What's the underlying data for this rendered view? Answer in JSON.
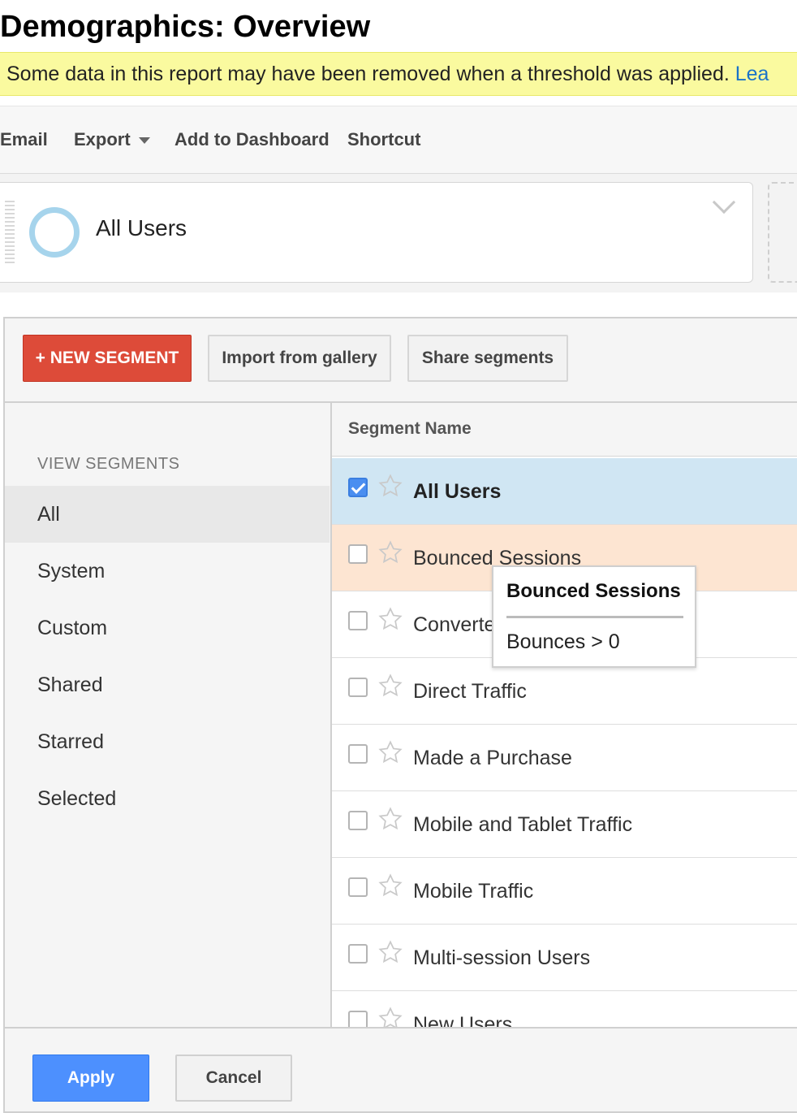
{
  "page_title": "Demographics: Overview",
  "notice": {
    "text": "Some data in this report may have been removed when a threshold was applied.",
    "link": "Lea"
  },
  "toolbar": {
    "email": "Email",
    "export": "Export",
    "add_to_dashboard": "Add to Dashboard",
    "shortcut": "Shortcut"
  },
  "segment_bar": {
    "active_segment": "All Users"
  },
  "segment_panel": {
    "new_segment": "+ NEW SEGMENT",
    "import": "Import from gallery",
    "share": "Share segments",
    "view_heading": "VIEW SEGMENTS",
    "nav": [
      "All",
      "System",
      "Custom",
      "Shared",
      "Starred",
      "Selected"
    ],
    "column_header": "Segment Name",
    "rows": [
      {
        "name": "All Users",
        "checked": true
      },
      {
        "name": "Bounced Sessions",
        "checked": false
      },
      {
        "name": "Converters",
        "checked": false
      },
      {
        "name": "Direct Traffic",
        "checked": false
      },
      {
        "name": "Made a Purchase",
        "checked": false
      },
      {
        "name": "Mobile and Tablet Traffic",
        "checked": false
      },
      {
        "name": "Mobile Traffic",
        "checked": false
      },
      {
        "name": "Multi-session Users",
        "checked": false
      },
      {
        "name": "New Users",
        "checked": false
      }
    ],
    "apply": "Apply",
    "cancel": "Cancel"
  },
  "tooltip": {
    "title": "Bounced Sessions",
    "body": "Bounces > 0"
  },
  "colors": {
    "new_segment": "#dd4b39",
    "apply": "#4d90fe",
    "selected_row": "#d0e6f3",
    "hover_row": "#fde5d2",
    "notice": "#fafa9f"
  }
}
